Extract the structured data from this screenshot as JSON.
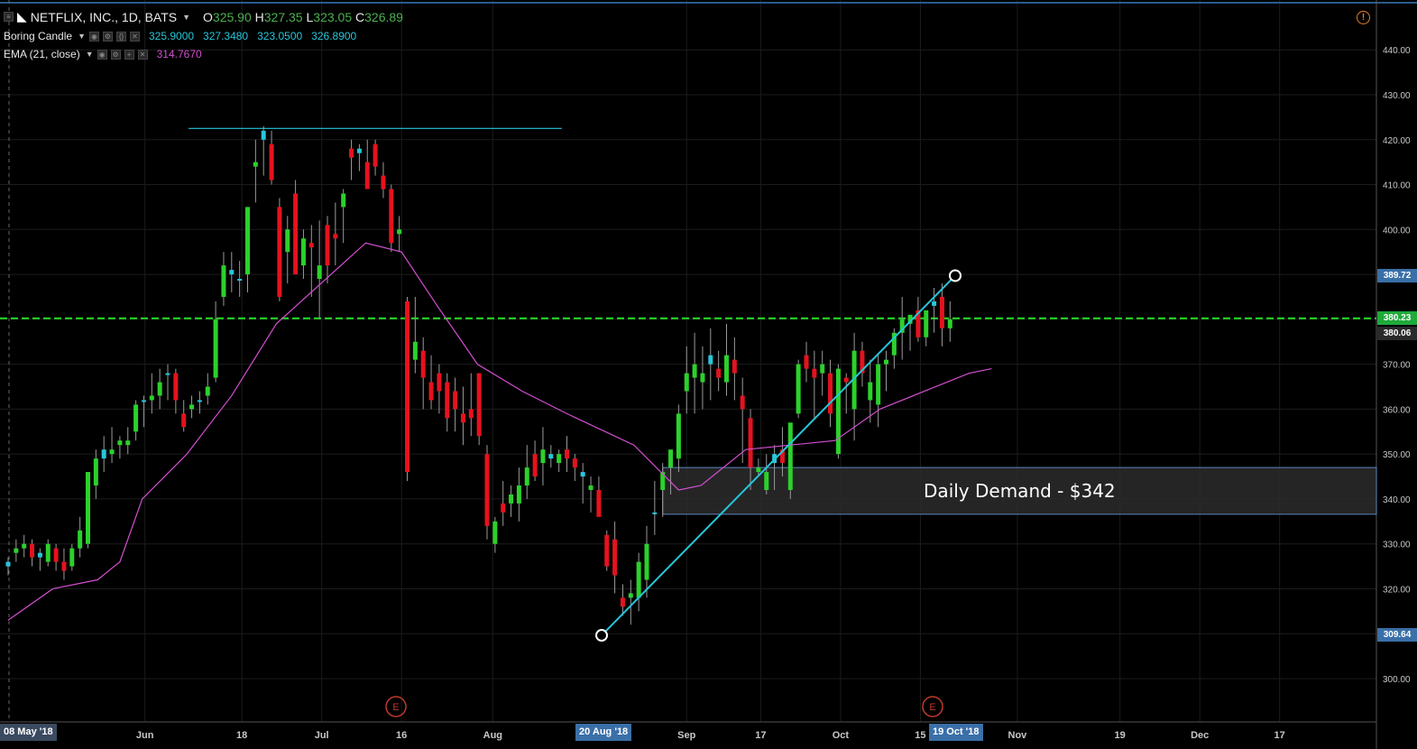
{
  "header": {
    "symbol": "NETFLIX, INC., 1D, BATS",
    "open_label": "O",
    "open": "325.90",
    "high_label": "H",
    "high": "327.35",
    "low_label": "L",
    "low": "323.05",
    "close_label": "C",
    "close": "326.89"
  },
  "indicators": [
    {
      "name": "Boring Candle",
      "values": [
        "325.9000",
        "327.3480",
        "323.0500",
        "326.8900"
      ],
      "color": "#26c6da"
    },
    {
      "name": "EMA (21, close)",
      "values": [
        "314.7670"
      ],
      "color": "#d34fd0"
    }
  ],
  "price_markers": {
    "upper": "389.72",
    "current_green": "380.23",
    "current_blue": "380.06",
    "lower": "309.64"
  },
  "time_markers": {
    "start": "08 May '18",
    "mid": "20 Aug '18",
    "end": "19 Oct '18"
  },
  "annotation": {
    "text": "Daily Demand - $342"
  },
  "earnings_label": "E",
  "colors": {
    "up": "#2bd12b",
    "down": "#e5121e",
    "neutral": "#26c6da",
    "ema": "#d34fd0",
    "trend": "#26c6da",
    "dashed": "#22e022"
  },
  "chart_data": {
    "type": "candlestick",
    "y_range": [
      292,
      445
    ],
    "y_ticks": [
      "300.00",
      "310.00",
      "320.00",
      "330.00",
      "340.00",
      "350.00",
      "360.00",
      "370.00",
      "380.00",
      "390.00",
      "400.00",
      "410.00",
      "420.00",
      "430.00",
      "440.00"
    ],
    "x_labels": [
      {
        "label": "Jun",
        "date": "2018-06-01"
      },
      {
        "label": "18",
        "date": "2018-06-18"
      },
      {
        "label": "Jul",
        "date": "2018-07-02"
      },
      {
        "label": "16",
        "date": "2018-07-16"
      },
      {
        "label": "Aug",
        "date": "2018-08-01"
      },
      {
        "label": "Sep",
        "date": "2018-09-04"
      },
      {
        "label": "17",
        "date": "2018-09-17"
      },
      {
        "label": "Oct",
        "date": "2018-10-01"
      },
      {
        "label": "15",
        "date": "2018-10-15"
      },
      {
        "label": "Nov",
        "date": "2018-11-01"
      },
      {
        "label": "19",
        "date": "2018-11-19"
      },
      {
        "label": "Dec",
        "date": "2018-12-03"
      },
      {
        "label": "17",
        "date": "2018-12-17"
      }
    ],
    "candles_ohlc": [
      [
        325,
        327,
        323,
        326
      ],
      [
        328,
        331,
        326,
        329
      ],
      [
        329,
        332,
        327,
        330
      ],
      [
        330,
        331,
        325,
        327
      ],
      [
        327,
        329,
        324,
        328
      ],
      [
        326,
        331,
        325,
        330
      ],
      [
        329,
        330,
        324,
        326
      ],
      [
        326,
        329,
        322,
        324
      ],
      [
        325,
        330,
        324,
        329
      ],
      [
        329,
        336,
        327,
        333
      ],
      [
        330,
        346,
        329,
        346
      ],
      [
        343,
        351,
        340,
        349
      ],
      [
        349,
        354,
        346,
        351
      ],
      [
        350,
        356,
        348,
        351
      ],
      [
        352,
        354,
        349,
        353
      ],
      [
        352,
        356,
        350,
        353
      ],
      [
        355,
        362,
        353,
        361
      ],
      [
        362,
        363,
        356,
        362
      ],
      [
        362,
        368,
        359,
        363
      ],
      [
        363,
        369,
        360,
        366
      ],
      [
        368,
        370,
        362,
        368
      ],
      [
        368,
        369,
        359,
        362
      ],
      [
        359,
        362,
        355,
        356
      ],
      [
        360,
        363,
        358,
        361
      ],
      [
        362,
        364,
        359,
        362
      ],
      [
        363,
        368,
        361,
        365
      ],
      [
        367,
        384,
        366,
        380
      ],
      [
        385,
        395,
        383,
        392
      ],
      [
        391,
        395,
        386,
        390
      ],
      [
        389,
        393,
        385,
        389
      ],
      [
        390,
        405,
        386,
        405
      ],
      [
        414,
        420,
        406,
        415
      ],
      [
        420,
        423,
        412,
        422
      ],
      [
        419,
        422,
        410,
        411
      ],
      [
        405,
        407,
        384,
        385
      ],
      [
        395,
        403,
        388,
        400
      ],
      [
        408,
        411,
        390,
        390
      ],
      [
        392,
        400,
        389,
        398
      ],
      [
        397,
        401,
        385,
        396
      ],
      [
        389,
        402,
        380,
        392
      ],
      [
        401,
        403,
        388,
        392
      ],
      [
        399,
        406,
        392,
        398
      ],
      [
        405,
        409,
        397,
        408
      ],
      [
        418,
        420,
        411,
        416
      ],
      [
        417,
        419,
        413,
        418
      ],
      [
        415,
        420,
        410,
        409
      ],
      [
        419,
        420,
        412,
        414
      ],
      [
        412,
        415,
        407,
        409
      ],
      [
        409,
        410,
        395,
        397
      ],
      [
        399,
        403,
        395,
        400
      ],
      [
        384,
        385,
        344,
        346
      ],
      [
        371,
        385,
        368,
        375
      ],
      [
        373,
        376,
        360,
        367
      ],
      [
        366,
        372,
        360,
        362
      ],
      [
        368,
        370,
        359,
        364
      ],
      [
        366,
        368,
        355,
        358
      ],
      [
        364,
        367,
        355,
        360
      ],
      [
        359,
        365,
        352,
        357
      ],
      [
        360,
        368,
        354,
        358
      ],
      [
        368,
        368,
        352,
        354
      ],
      [
        350,
        352,
        331,
        334
      ],
      [
        330,
        336,
        328,
        335
      ],
      [
        339,
        344,
        334,
        337
      ],
      [
        339,
        343,
        336,
        341
      ],
      [
        339,
        347,
        335,
        343
      ],
      [
        343,
        352,
        340,
        347
      ],
      [
        350,
        353,
        344,
        345
      ],
      [
        348,
        356,
        343,
        351
      ],
      [
        350,
        352,
        347,
        349
      ],
      [
        348,
        351,
        346,
        350
      ],
      [
        351,
        354,
        346,
        349
      ],
      [
        349,
        350,
        344,
        347
      ],
      [
        346,
        348,
        339,
        345
      ],
      [
        342,
        345,
        337,
        343
      ],
      [
        342,
        345,
        337,
        336
      ],
      [
        332,
        333,
        324,
        325
      ],
      [
        331,
        335,
        319,
        323
      ],
      [
        318,
        321,
        314,
        316
      ],
      [
        318,
        322,
        312,
        319
      ],
      [
        318,
        328,
        315,
        326
      ],
      [
        322,
        334,
        318,
        330
      ],
      [
        337,
        344,
        332,
        337
      ],
      [
        342,
        348,
        336,
        346
      ],
      [
        347,
        350,
        341,
        351
      ],
      [
        349,
        361,
        346,
        359
      ],
      [
        364,
        374,
        359,
        368
      ],
      [
        367,
        377,
        359,
        370
      ],
      [
        366,
        374,
        360,
        368
      ],
      [
        370,
        378,
        362,
        372
      ],
      [
        369,
        373,
        364,
        367
      ],
      [
        366,
        379,
        363,
        372
      ],
      [
        371,
        376,
        362,
        368
      ],
      [
        363,
        367,
        348,
        360
      ],
      [
        358,
        360,
        342,
        347
      ],
      [
        346,
        349,
        345,
        347
      ],
      [
        342,
        350,
        341,
        346
      ],
      [
        348,
        352,
        342,
        350
      ],
      [
        351,
        356,
        345,
        348
      ],
      [
        342,
        356,
        340,
        357
      ],
      [
        359,
        371,
        358,
        370
      ],
      [
        372,
        375,
        366,
        369
      ],
      [
        369,
        373,
        358,
        367
      ],
      [
        368,
        373,
        363,
        370
      ],
      [
        368,
        371,
        356,
        359
      ],
      [
        350,
        370,
        349,
        369
      ],
      [
        367,
        368,
        359,
        366
      ],
      [
        360,
        377,
        353,
        373
      ],
      [
        373,
        375,
        365,
        368
      ],
      [
        362,
        371,
        357,
        366
      ],
      [
        361,
        372,
        356,
        370
      ],
      [
        370,
        373,
        364,
        371
      ],
      [
        372,
        378,
        369,
        377
      ],
      [
        377,
        385,
        371,
        380
      ],
      [
        379,
        381,
        373,
        381
      ],
      [
        382,
        385,
        375,
        376
      ],
      [
        376,
        381,
        374,
        382
      ],
      [
        383,
        387,
        377,
        384
      ],
      [
        385,
        388,
        374,
        378
      ],
      [
        378,
        384,
        375,
        380
      ]
    ],
    "ema_21": [
      [
        0,
        313
      ],
      [
        10,
        320
      ],
      [
        20,
        322
      ],
      [
        25,
        326
      ],
      [
        30,
        340
      ],
      [
        40,
        350
      ],
      [
        50,
        363
      ],
      [
        60,
        379
      ],
      [
        70,
        388
      ],
      [
        80,
        397
      ],
      [
        88,
        395
      ],
      [
        96,
        383
      ],
      [
        105,
        370
      ],
      [
        115,
        364
      ],
      [
        125,
        359
      ],
      [
        140,
        352
      ],
      [
        150,
        342
      ],
      [
        155,
        343
      ],
      [
        165,
        351
      ],
      [
        175,
        352
      ],
      [
        185,
        353
      ],
      [
        195,
        360
      ],
      [
        205,
        364
      ],
      [
        215,
        368
      ],
      [
        220,
        369
      ]
    ],
    "trendline": {
      "from": {
        "candle": 80,
        "price": 309.64
      },
      "to": {
        "candle": 154,
        "price": 389.72
      }
    },
    "horizontal_line": {
      "price": 422.5,
      "from_candle": 26,
      "to_candle": 68
    },
    "dashed_price": 380.23,
    "demand_zone": {
      "top": 347,
      "bottom": 336.6,
      "from_candle": 82
    }
  }
}
